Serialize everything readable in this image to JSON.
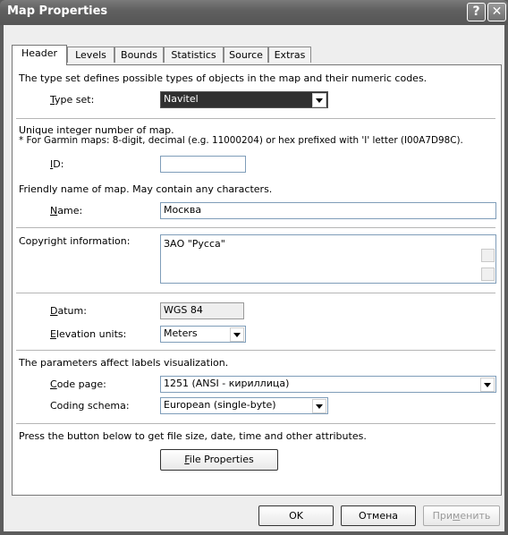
{
  "window": {
    "title": "Map Properties",
    "help": "?",
    "close": "✕"
  },
  "tabs": [
    "Header",
    "Levels",
    "Bounds",
    "Statistics",
    "Source",
    "Extras"
  ],
  "typeset": {
    "desc": "The type set defines possible types of objects in the map and their numeric codes.",
    "label_u": "T",
    "label_rest": "ype set:",
    "value": "Navitel"
  },
  "id": {
    "desc1": "Unique integer number of map.",
    "desc2": "* For Garmin maps: 8-digit, decimal (e.g. 11000204) or hex prefixed with 'I' letter (I00A7D98C).",
    "label_u": "I",
    "label_rest": "D:",
    "value": ""
  },
  "name": {
    "desc": "Friendly name of map. May contain any characters.",
    "label_u": "N",
    "label_rest": "ame:",
    "value": "Москва"
  },
  "copyright": {
    "label": "Copyright information:",
    "value": "ЗАО \"Русса\""
  },
  "datum": {
    "label_u": "D",
    "label_rest": "atum:",
    "value": "WGS 84"
  },
  "elevation": {
    "label_u": "E",
    "label_rest": "levation units:",
    "value": "Meters"
  },
  "labels": {
    "desc": "The parameters affect labels visualization.",
    "codepage_u": "C",
    "codepage_rest": "ode page:",
    "codepage_value": "1251  (ANSI - кириллица)",
    "schema_label": "Coding schema:",
    "schema_value": "European (single-byte)"
  },
  "fileprops": {
    "desc": "Press the button below to get file size, date, time and other attributes.",
    "button_u": "F",
    "button_rest": "ile Properties"
  },
  "footer": {
    "ok": "OK",
    "cancel": "Отмена",
    "apply_a": "При",
    "apply_u": "м",
    "apply_b": "енить"
  }
}
